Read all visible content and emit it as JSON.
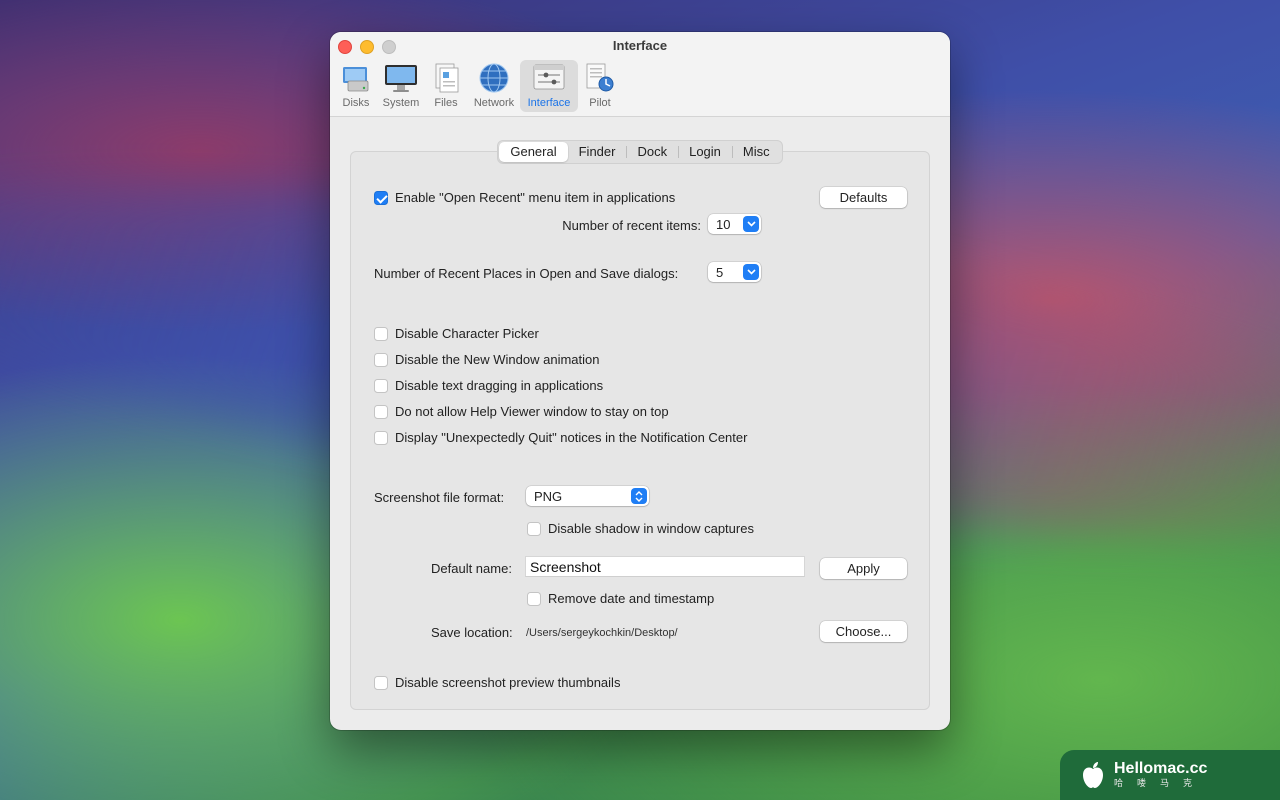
{
  "window": {
    "title": "Interface"
  },
  "toolbar": {
    "items": [
      {
        "label": "Disks",
        "icon": "disks-icon"
      },
      {
        "label": "System",
        "icon": "monitor-icon"
      },
      {
        "label": "Files",
        "icon": "files-icon"
      },
      {
        "label": "Network",
        "icon": "globe-icon"
      },
      {
        "label": "Interface",
        "icon": "interface-icon",
        "active": true
      },
      {
        "label": "Pilot",
        "icon": "pilot-icon"
      }
    ]
  },
  "tabs": [
    "General",
    "Finder",
    "Dock",
    "Login",
    "Misc"
  ],
  "selected_tab": "General",
  "general": {
    "open_recent_label": "Enable \"Open Recent\" menu item in applications",
    "open_recent_checked": true,
    "defaults_button": "Defaults",
    "recent_items_label": "Number of recent items:",
    "recent_items_value": "10",
    "recent_places_label": "Number of Recent Places in Open and Save dialogs:",
    "recent_places_value": "5",
    "options": [
      {
        "label": "Disable Character Picker",
        "checked": false
      },
      {
        "label": "Disable the New Window animation",
        "checked": false
      },
      {
        "label": "Disable text dragging in applications",
        "checked": false
      },
      {
        "label": "Do not allow Help Viewer window to stay on top",
        "checked": false
      },
      {
        "label": "Display \"Unexpectedly Quit\" notices in the Notification Center",
        "checked": false
      }
    ],
    "screenshot_format_label": "Screenshot file format:",
    "screenshot_format_value": "PNG",
    "disable_shadow_label": "Disable shadow in window captures",
    "default_name_label": "Default name:",
    "default_name_value": "Screenshot",
    "apply_button": "Apply",
    "remove_timestamp_label": "Remove date and timestamp",
    "save_location_label": "Save location:",
    "save_location_value": "/Users/sergeykochkin/Desktop/",
    "choose_button": "Choose...",
    "disable_thumbnails_label": "Disable screenshot preview thumbnails"
  },
  "watermark": {
    "title": "Hellomac.cc",
    "subtitle": "哈喽马克"
  },
  "colors": {
    "accent": "#1f7ef5",
    "close": "#fe5f57",
    "minimize": "#febc2e"
  }
}
